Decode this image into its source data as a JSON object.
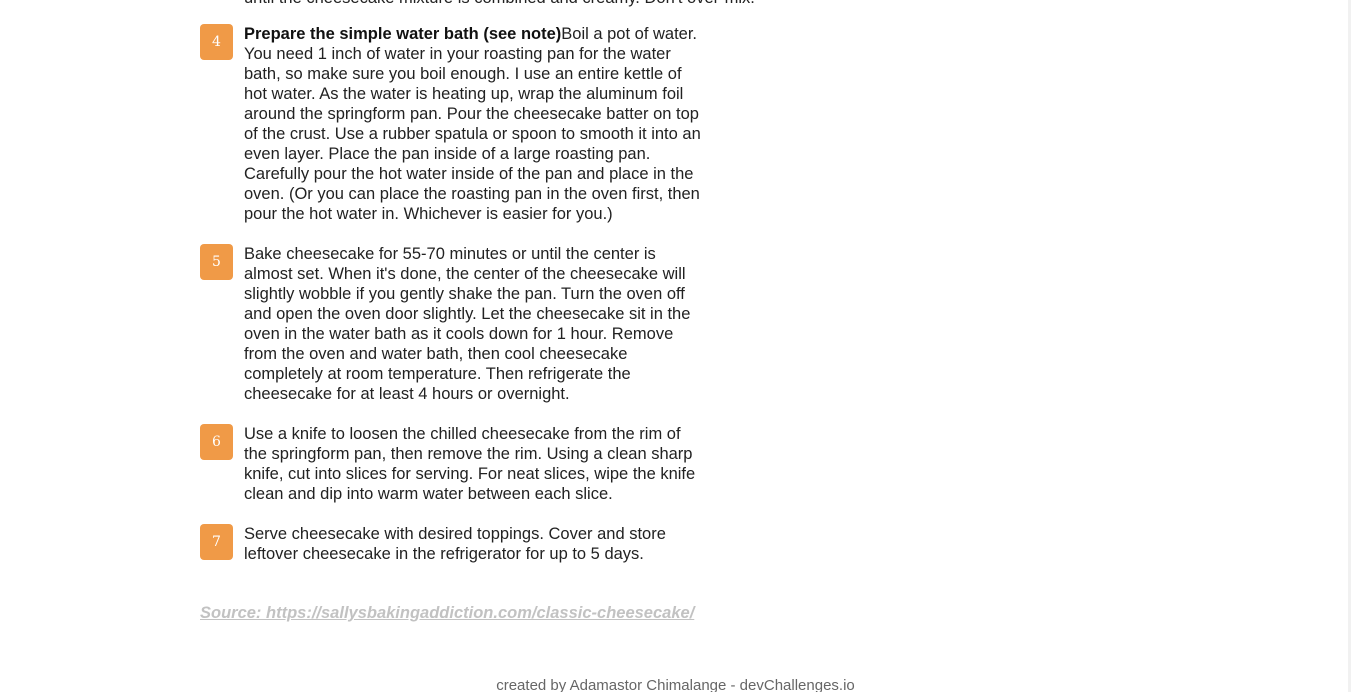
{
  "partial_previous_line": "until the cheesecake mixture is combined and creamy. Don't over-mix.",
  "steps": [
    {
      "number": "4",
      "title": "Prepare the simple water bath (see note)",
      "text_lines": [
        "Boil a pot of water.",
        "You need 1 inch of water in your roasting pan for the water",
        "bath, so make sure you boil enough. I use an entire kettle of",
        "hot water. As the water is heating up, wrap the aluminum foil",
        "around the springform pan. Pour the cheesecake batter on top",
        "of the crust. Use a rubber spatula or spoon to smooth it into an",
        "even layer. Place the pan inside of a large roasting pan.",
        "Carefully pour the hot water inside of the pan and place in the",
        "oven. (Or you can place the roasting pan in the oven first, then",
        "pour the hot water in. Whichever is easier for you.)"
      ]
    },
    {
      "number": "5",
      "title": "",
      "text_lines": [
        "Bake cheesecake for 55-70 minutes or until the center is",
        "almost set. When it's done, the center of the cheesecake will",
        "slightly wobble if you gently shake the pan. Turn the oven off",
        "and open the oven door slightly. Let the cheesecake sit in the",
        "oven in the water bath as it cools down for 1 hour. Remove",
        "from the oven and water bath, then cool cheesecake",
        "completely at room temperature. Then refrigerate the",
        "cheesecake for at least 4 hours or overnight."
      ]
    },
    {
      "number": "6",
      "title": "",
      "text_lines": [
        "Use a knife to loosen the chilled cheesecake from the rim of",
        "the springform pan, then remove the rim. Using a clean sharp",
        "knife, cut into slices for serving. For neat slices, wipe the knife",
        "clean and dip into warm water between each slice."
      ]
    },
    {
      "number": "7",
      "title": "",
      "text_lines": [
        "Serve cheesecake with desired toppings. Cover and store",
        "leftover cheesecake in the refrigerator for up to 5 days."
      ]
    }
  ],
  "source": {
    "label": "Source: https://sallysbakingaddiction.com/classic-cheesecake/"
  },
  "footer": {
    "text": "created by Adamastor Chimalange - devChallenges.io"
  },
  "colors": {
    "step_badge": "#f09a47",
    "source_link": "#c2c2c2",
    "footer_text": "#666666"
  }
}
